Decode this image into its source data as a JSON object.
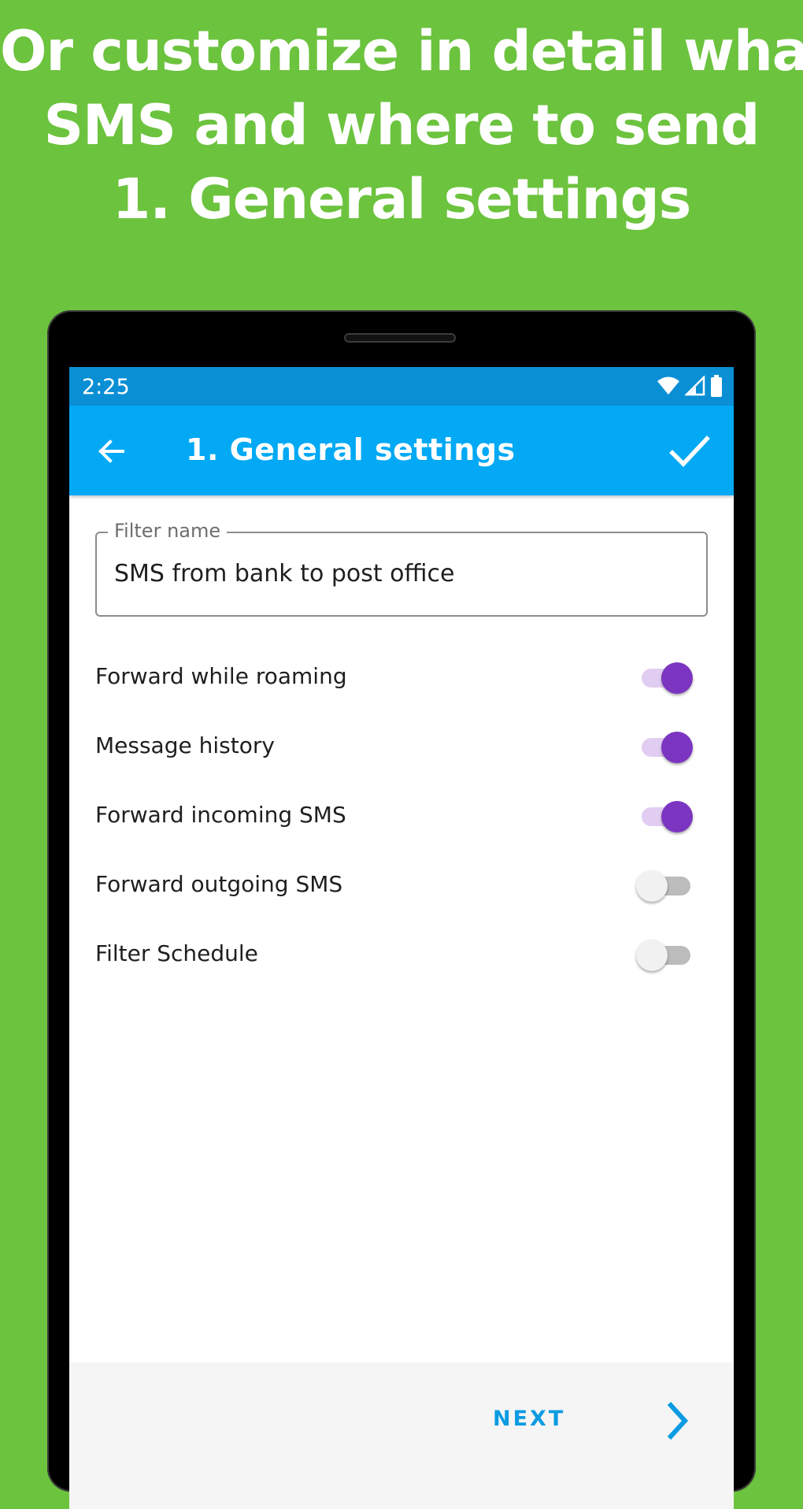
{
  "headline": {
    "line1": "Or customize in detail what",
    "line2": "SMS and where to send",
    "line3": "1. General settings"
  },
  "statusbar": {
    "time": "2:25",
    "icons": [
      "wifi-icon",
      "signal-icon",
      "battery-icon"
    ]
  },
  "appbar": {
    "title": "1. General settings",
    "back_icon": "arrow-left-icon",
    "confirm_icon": "check-icon"
  },
  "filter_name": {
    "label": "Filter name",
    "value": "SMS from bank to post office"
  },
  "settings": [
    {
      "label": "Forward while roaming",
      "enabled": true
    },
    {
      "label": "Message history",
      "enabled": true
    },
    {
      "label": "Forward incoming SMS",
      "enabled": true
    },
    {
      "label": "Forward outgoing SMS",
      "enabled": false
    },
    {
      "label": "Filter Schedule",
      "enabled": false
    }
  ],
  "footer": {
    "next_label": "NEXT",
    "next_icon": "chevron-right-icon"
  },
  "colors": {
    "background": "#6cc33e",
    "statusbar": "#0a8fd4",
    "appbar": "#03a9f4",
    "switch_on": "#7b35c1",
    "switch_on_track": "#e2cdf2",
    "accent_text": "#0a9be2"
  }
}
